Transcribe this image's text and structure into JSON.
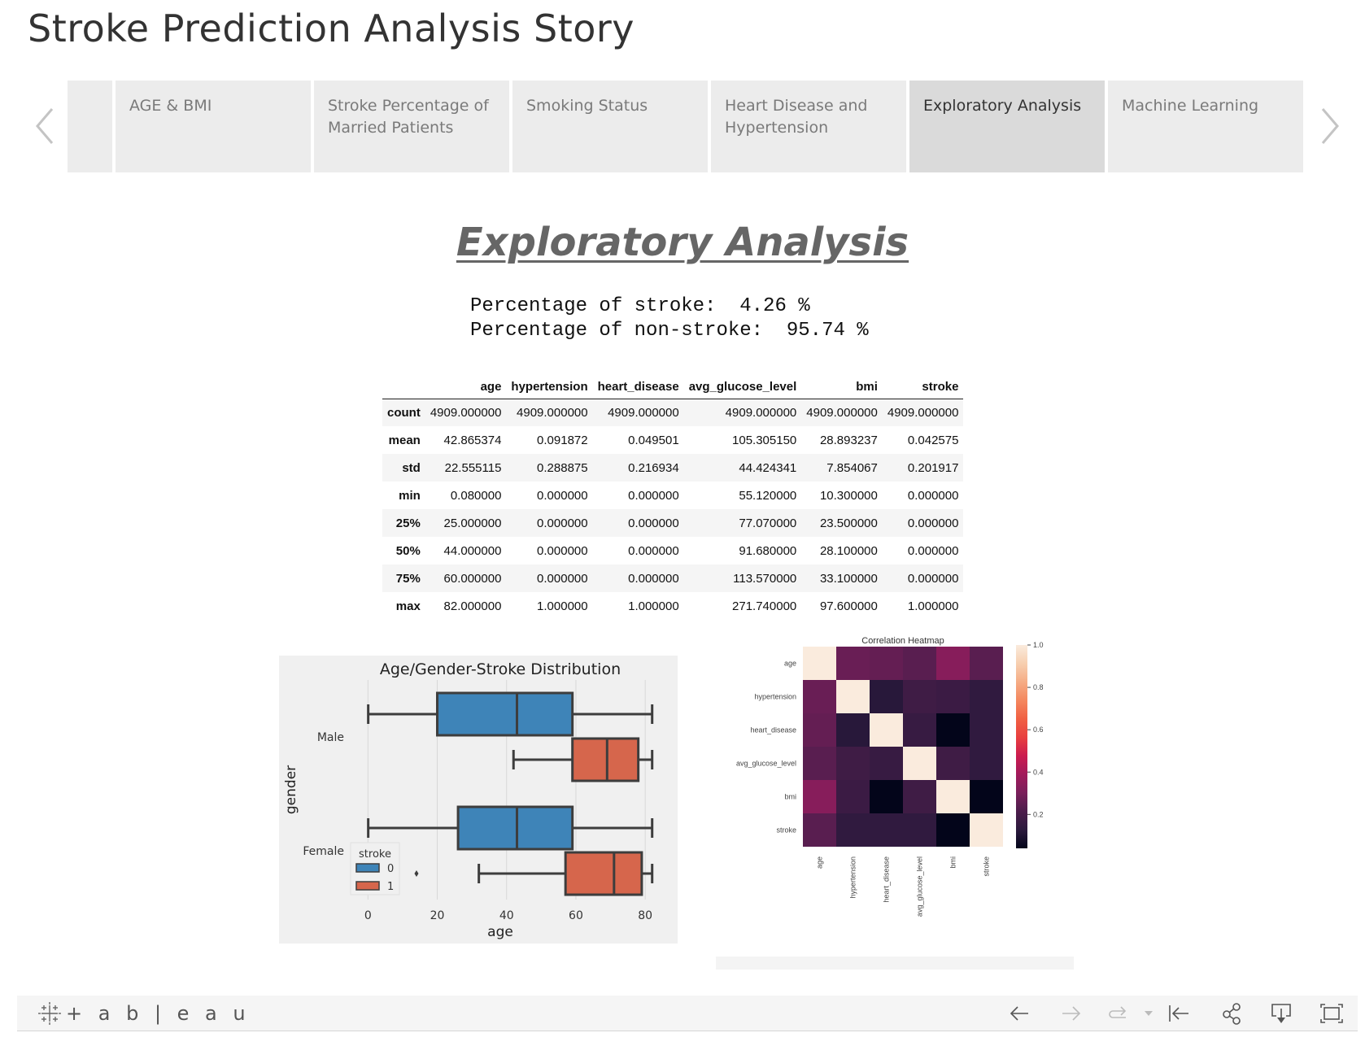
{
  "story": {
    "title": "Stroke Prediction Analysis Story"
  },
  "nav": {
    "prev_icon": "chevron-left-icon",
    "next_icon": "chevron-right-icon",
    "tabs": [
      {
        "label": ""
      },
      {
        "label": "AGE & BMI"
      },
      {
        "label": "Stroke Percentage of Married Patients"
      },
      {
        "label": "Smoking Status"
      },
      {
        "label": "Heart Disease and Hypertension"
      },
      {
        "label": "Exploratory Analysis",
        "active": true
      },
      {
        "label": "Machine Learning"
      }
    ]
  },
  "main": {
    "heading": "Exploratory Analysis",
    "pct_lines": [
      "Percentage of stroke:  4.26 %",
      "Percentage of non-stroke:  95.74 %"
    ],
    "describe_table": {
      "columns": [
        "",
        "age",
        "hypertension",
        "heart_disease",
        "avg_glucose_level",
        "bmi",
        "stroke"
      ],
      "rows": [
        [
          "count",
          "4909.000000",
          "4909.000000",
          "4909.000000",
          "4909.000000",
          "4909.000000",
          "4909.000000"
        ],
        [
          "mean",
          "42.865374",
          "0.091872",
          "0.049501",
          "105.305150",
          "28.893237",
          "0.042575"
        ],
        [
          "std",
          "22.555115",
          "0.288875",
          "0.216934",
          "44.424341",
          "7.854067",
          "0.201917"
        ],
        [
          "min",
          "0.080000",
          "0.000000",
          "0.000000",
          "55.120000",
          "10.300000",
          "0.000000"
        ],
        [
          "25%",
          "25.000000",
          "0.000000",
          "0.000000",
          "77.070000",
          "23.500000",
          "0.000000"
        ],
        [
          "50%",
          "44.000000",
          "0.000000",
          "0.000000",
          "91.680000",
          "28.100000",
          "0.000000"
        ],
        [
          "75%",
          "60.000000",
          "0.000000",
          "0.000000",
          "113.570000",
          "33.100000",
          "0.000000"
        ],
        [
          "max",
          "82.000000",
          "1.000000",
          "1.000000",
          "271.740000",
          "97.600000",
          "1.000000"
        ]
      ]
    }
  },
  "chart_data": [
    {
      "type": "box",
      "title": "Age/Gender-Stroke Distribution",
      "xlabel": "age",
      "ylabel": "gender",
      "categories": [
        "Male",
        "Female"
      ],
      "xlim": [
        -5,
        87
      ],
      "xticks": [
        0,
        20,
        40,
        60,
        80
      ],
      "grid": "vertical",
      "legend": {
        "title": "stroke",
        "position": "lower-left",
        "entries": [
          "0",
          "1"
        ]
      },
      "colors": {
        "0": "#3e84b8",
        "1": "#d6664c",
        "edge": "#3d3d3d",
        "background": "#f0f0f0"
      },
      "series": [
        {
          "name": "0",
          "boxes": [
            {
              "category": "Male",
              "whisker_low": 0.08,
              "q1": 20,
              "median": 43,
              "q3": 59,
              "whisker_high": 82
            },
            {
              "category": "Female",
              "whisker_low": 0.08,
              "q1": 26,
              "median": 43,
              "q3": 59,
              "whisker_high": 82
            }
          ]
        },
        {
          "name": "1",
          "boxes": [
            {
              "category": "Male",
              "whisker_low": 42,
              "q1": 59,
              "median": 69,
              "q3": 78,
              "whisker_high": 82
            },
            {
              "category": "Female",
              "whisker_low": 32,
              "q1": 57,
              "median": 71,
              "q3": 79,
              "whisker_high": 82,
              "outliers": [
                14
              ]
            }
          ]
        }
      ]
    },
    {
      "type": "heatmap",
      "title": "Correlation Heatmap",
      "x": [
        "age",
        "hypertension",
        "heart_disease",
        "avg_glucose_level",
        "bmi",
        "stroke"
      ],
      "y": [
        "age",
        "hypertension",
        "heart_disease",
        "avg_glucose_level",
        "bmi",
        "stroke"
      ],
      "values": [
        [
          1.0,
          0.27,
          0.26,
          0.24,
          0.33,
          0.24
        ],
        [
          0.27,
          1.0,
          0.12,
          0.18,
          0.17,
          0.14
        ],
        [
          0.26,
          0.12,
          1.0,
          0.16,
          0.04,
          0.14
        ],
        [
          0.24,
          0.18,
          0.16,
          1.0,
          0.18,
          0.14
        ],
        [
          0.33,
          0.17,
          0.04,
          0.18,
          1.0,
          0.04
        ],
        [
          0.24,
          0.14,
          0.14,
          0.14,
          0.04,
          1.0
        ]
      ],
      "colorbar": {
        "range": [
          0.04,
          1.0
        ],
        "ticks": [
          0.2,
          0.4,
          0.6,
          0.8,
          1.0
        ]
      },
      "colormap": [
        "#03051a",
        "#2b1a3d",
        "#4c1d4b",
        "#7a1f5b",
        "#a11a5b",
        "#cb1b4f",
        "#e83f3f",
        "#f06043",
        "#f4875e",
        "#f5ac85",
        "#f7cfb0",
        "#faebdd"
      ]
    }
  ],
  "toolbar": {
    "logo_text": "+ a b | e a u",
    "buttons": [
      {
        "name": "undo-button",
        "icon": "arrow-left-icon"
      },
      {
        "name": "redo-button",
        "icon": "arrow-right-icon"
      },
      {
        "name": "revert-button",
        "icon": "revert-icon"
      },
      {
        "name": "revert-dropdown-button",
        "icon": "caret-down-icon"
      },
      {
        "name": "revert-to-start-button",
        "icon": "arrow-to-start-icon"
      },
      {
        "name": "share-button",
        "icon": "share-icon"
      },
      {
        "name": "download-button",
        "icon": "download-icon"
      },
      {
        "name": "fullscreen-button",
        "icon": "fullscreen-icon"
      }
    ]
  }
}
